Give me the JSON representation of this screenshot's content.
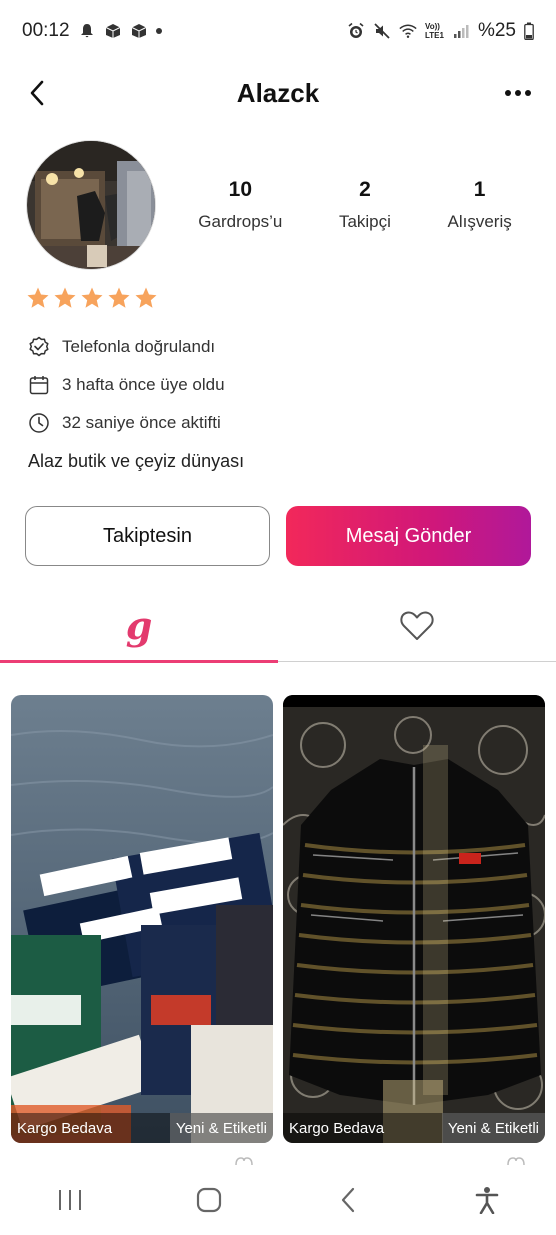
{
  "status_bar": {
    "time": "00:12",
    "battery": "%25",
    "network": "Vo))\nLTE1"
  },
  "header": {
    "title": "Alazck"
  },
  "profile": {
    "stats": [
      {
        "value": "10",
        "label": "Gardrops’u"
      },
      {
        "value": "2",
        "label": "Takipçi"
      },
      {
        "value": "1",
        "label": "Alışveriş"
      }
    ],
    "rating": 5,
    "info": [
      {
        "icon": "verified-badge-icon",
        "text": "Telefonla doğrulandı"
      },
      {
        "icon": "calendar-icon",
        "text": "3 hafta önce üye oldu"
      },
      {
        "icon": "clock-icon",
        "text": "32 saniye önce aktifti"
      }
    ],
    "bio": "Alaz butik ve çeyiz dünyası"
  },
  "actions": {
    "follow_label": "Takiptesin",
    "message_label": "Mesaj Gönder"
  },
  "tabs": {
    "closet_glyph": "g",
    "favorites_icon": "heart-icon",
    "active": "closet"
  },
  "products": [
    {
      "badge_cargo": "Kargo Bedava",
      "badge_new": "Yeni & Etiketli",
      "photo": "boxed underwear sets"
    },
    {
      "badge_cargo": "Kargo Bedava",
      "badge_new": "Yeni & Etiketli",
      "photo": "black puffer vest"
    }
  ],
  "colors": {
    "accent": "#ec3d75",
    "star": "#f7a35c",
    "button_gradient_start": "#f2285a",
    "button_gradient_end": "#b0189a"
  }
}
